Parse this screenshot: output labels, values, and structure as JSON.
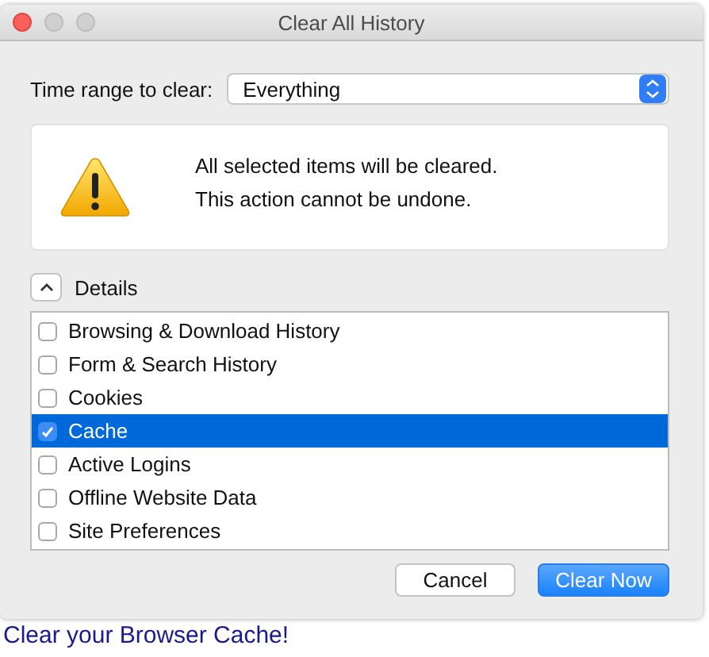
{
  "window": {
    "title": "Clear All History"
  },
  "time_range": {
    "label": "Time range to clear:",
    "value": "Everything"
  },
  "warning": {
    "lines": [
      "All selected items will be cleared.",
      "This action cannot be undone."
    ]
  },
  "details": {
    "label": "Details",
    "expanded": true
  },
  "items": [
    {
      "label": "Browsing & Download History",
      "checked": false,
      "selected": false
    },
    {
      "label": "Form & Search History",
      "checked": false,
      "selected": false
    },
    {
      "label": "Cookies",
      "checked": false,
      "selected": false
    },
    {
      "label": "Cache",
      "checked": true,
      "selected": true
    },
    {
      "label": "Active Logins",
      "checked": false,
      "selected": false
    },
    {
      "label": "Offline Website Data",
      "checked": false,
      "selected": false
    },
    {
      "label": "Site Preferences",
      "checked": false,
      "selected": false
    }
  ],
  "buttons": [
    {
      "label": "Cancel",
      "kind": "secondary"
    },
    {
      "label": "Clear Now",
      "kind": "primary"
    }
  ],
  "background_page": {
    "heading": "Clear your Browser Cache!"
  }
}
